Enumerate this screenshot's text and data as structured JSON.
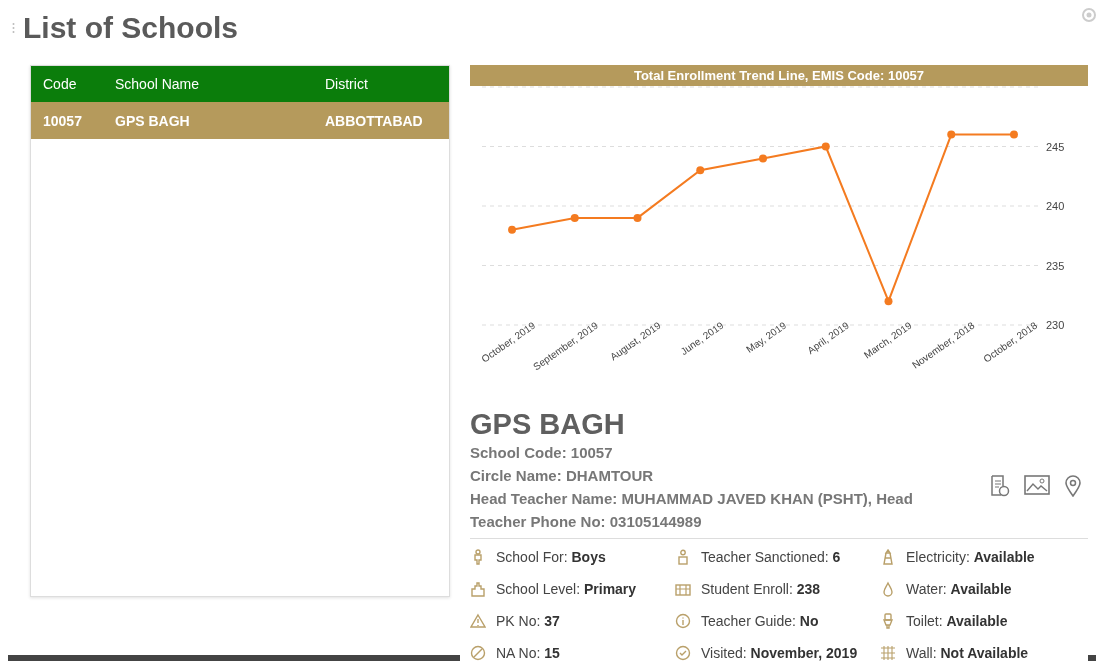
{
  "title": "List of Schools",
  "table": {
    "columns": [
      "Code",
      "School Name",
      "District"
    ],
    "rows": [
      {
        "cells": [
          "10057",
          "GPS BAGH",
          "ABBOTTABAD"
        ],
        "selected": true
      }
    ]
  },
  "chart_data": {
    "type": "line",
    "title": "Total Enrollment Trend Line, EMIS Code: 10057",
    "categories": [
      "October, 2019",
      "September, 2019",
      "August, 2019",
      "June, 2019",
      "May, 2019",
      "April, 2019",
      "March, 2019",
      "November, 2018",
      "October, 2018"
    ],
    "series": [
      {
        "color": "#f47b20",
        "marker": true,
        "values": [
          238,
          239,
          239,
          243,
          244,
          245,
          232,
          246,
          246
        ]
      }
    ],
    "ylim": [
      230,
      250
    ],
    "yticks": [
      230,
      235,
      240,
      245
    ],
    "grid": true
  },
  "school": {
    "name": "GPS BAGH",
    "lines": [
      {
        "label": "School Code:",
        "value": "10057"
      },
      {
        "label": "Circle Name:",
        "value": "DHAMTOUR"
      },
      {
        "label": "Head Teacher Name:",
        "value": "MUHAMMAD JAVED KHAN (PSHT), Head Teacher Phone No: 03105144989"
      }
    ]
  },
  "facts": [
    {
      "label": "School For:",
      "value": "Boys"
    },
    {
      "label": "Teacher Sanctioned:",
      "value": "6"
    },
    {
      "label": "Electricity:",
      "value": "Available"
    },
    {
      "label": "School Level:",
      "value": "Primary"
    },
    {
      "label": "Student Enroll:",
      "value": "238"
    },
    {
      "label": "Water:",
      "value": "Available"
    },
    {
      "label": "PK No:",
      "value": "37"
    },
    {
      "label": "Teacher Guide:",
      "value": "No"
    },
    {
      "label": "Toilet:",
      "value": "Available"
    },
    {
      "label": "NA No:",
      "value": "15"
    },
    {
      "label": "Visited:",
      "value": "November, 2019"
    },
    {
      "label": "Wall:",
      "value": "Not Available"
    }
  ]
}
